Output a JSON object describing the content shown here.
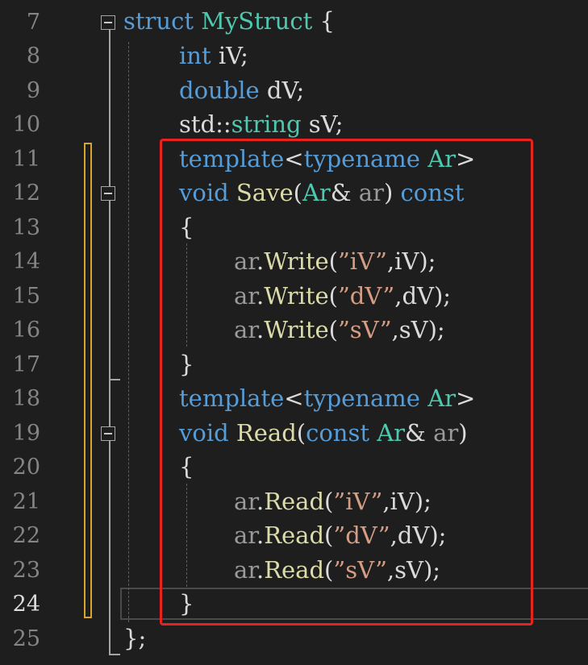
{
  "editor": {
    "line_numbers": [
      "7",
      "8",
      "9",
      "10",
      "11",
      "12",
      "13",
      "14",
      "15",
      "16",
      "17",
      "18",
      "19",
      "20",
      "21",
      "22",
      "23",
      "24",
      "25"
    ],
    "active_line": "24",
    "lines": {
      "l7": {
        "kw": "struct",
        "name": "MyStruct",
        "brace": "{"
      },
      "l8": {
        "type": "int",
        "rest": "iV;"
      },
      "l9": {
        "type": "double",
        "rest": "dV;"
      },
      "l10": {
        "ns": "std::",
        "type": "string",
        "rest": "sV;"
      },
      "l11": {
        "kw": "template",
        "lt": "<",
        "kw2": "typename",
        "tp": "Ar",
        "gt": ">"
      },
      "l12": {
        "kw": "void",
        "fn": "Save",
        "open": "(",
        "tp": "Ar",
        "amp": "&",
        "param": "ar",
        "close": ")",
        "kw2": "const"
      },
      "l13": {
        "brace": "{"
      },
      "l14": {
        "obj": "ar",
        "dot": ".",
        "fn": "Write",
        "open": "(",
        "str": "”iV”",
        "comma": ",",
        "arg": "iV",
        "close": ");"
      },
      "l15": {
        "obj": "ar",
        "dot": ".",
        "fn": "Write",
        "open": "(",
        "str": "”dV”",
        "comma": ",",
        "arg": "dV",
        "close": ");"
      },
      "l16": {
        "obj": "ar",
        "dot": ".",
        "fn": "Write",
        "open": "(",
        "str": "”sV”",
        "comma": ",",
        "arg": "sV",
        "close": ");"
      },
      "l17": {
        "brace": "}"
      },
      "l18": {
        "kw": "template",
        "lt": "<",
        "kw2": "typename",
        "tp": "Ar",
        "gt": ">"
      },
      "l19": {
        "kw": "void",
        "fn": "Read",
        "open": "(",
        "kw2": "const",
        "tp": "Ar",
        "amp": "&",
        "param": "ar",
        "close": ")"
      },
      "l20": {
        "brace": "{"
      },
      "l21": {
        "obj": "ar",
        "dot": ".",
        "fn": "Read",
        "open": "(",
        "str": "”iV”",
        "comma": ",",
        "arg": "iV",
        "close": ");"
      },
      "l22": {
        "obj": "ar",
        "dot": ".",
        "fn": "Read",
        "open": "(",
        "str": "”dV”",
        "comma": ",",
        "arg": "dV",
        "close": ");"
      },
      "l23": {
        "obj": "ar",
        "dot": ".",
        "fn": "Read",
        "open": "(",
        "str": "”sV”",
        "comma": ",",
        "arg": "sV",
        "close": ");"
      },
      "l24": {
        "brace": "}"
      },
      "l25": {
        "close": "};"
      }
    }
  },
  "colors": {
    "background": "#1e1e1e",
    "keyword": "#569cd6",
    "type": "#4ec9b0",
    "function": "#dcdcaa",
    "string": "#d69d85",
    "parameter": "#9a9a9a",
    "change_marker": "#d7a52b",
    "highlight_box": "#e8231e"
  }
}
